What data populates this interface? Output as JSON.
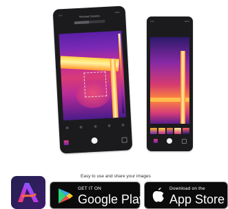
{
  "phone_large": {
    "status_left": "9:41",
    "status_right": "100%",
    "title": "Thermal Camera"
  },
  "phone_small": {
    "status_left": "9:41",
    "status_right": "100%"
  },
  "tagline": "Easy to use and share your images",
  "badges": {
    "google": {
      "small": "GET IT ON",
      "large": "Google Play"
    },
    "apple": {
      "small": "Download on the",
      "large": "App Store"
    }
  },
  "colors": {
    "badge_bg": "#0b0b0b",
    "thermal_hot": "#fff3a0",
    "thermal_warm": "#ff9a2e",
    "thermal_mid": "#d93b77",
    "thermal_cool": "#5b1fa6"
  },
  "icons": {
    "app": "thermal-app-icon",
    "google": "google-play-icon",
    "apple": "apple-icon"
  }
}
